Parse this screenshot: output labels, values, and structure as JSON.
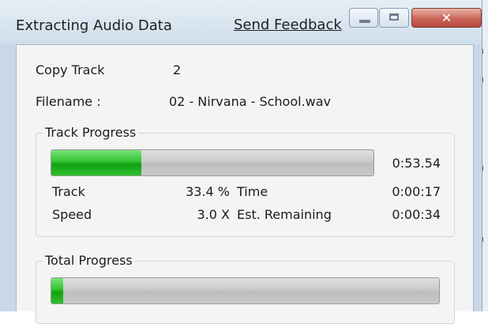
{
  "window": {
    "title": "Extracting Audio Data",
    "feedback_link": "Send Feedback",
    "close_glyph": "✕"
  },
  "details": {
    "copy_track_label": "Copy Track",
    "copy_track_value": "2",
    "filename_label": "Filename :",
    "filename_value": "02 - Nirvana - School.wav"
  },
  "track_progress": {
    "title": "Track Progress",
    "fraction": 0.28,
    "duration": "0:53.54",
    "track_label": "Track",
    "track_value": "33.4 %",
    "time_label": "Time",
    "time_value": "0:00:17",
    "speed_label": "Speed",
    "speed_value": "3.0 X",
    "remaining_label": "Est. Remaining",
    "remaining_value": "0:00:34"
  },
  "total_progress": {
    "title": "Total Progress",
    "fraction": 0.03
  },
  "colors": {
    "progress_green": "#1fb01f",
    "titlebar": "#d6e3ef",
    "close_button": "#c9645a"
  }
}
